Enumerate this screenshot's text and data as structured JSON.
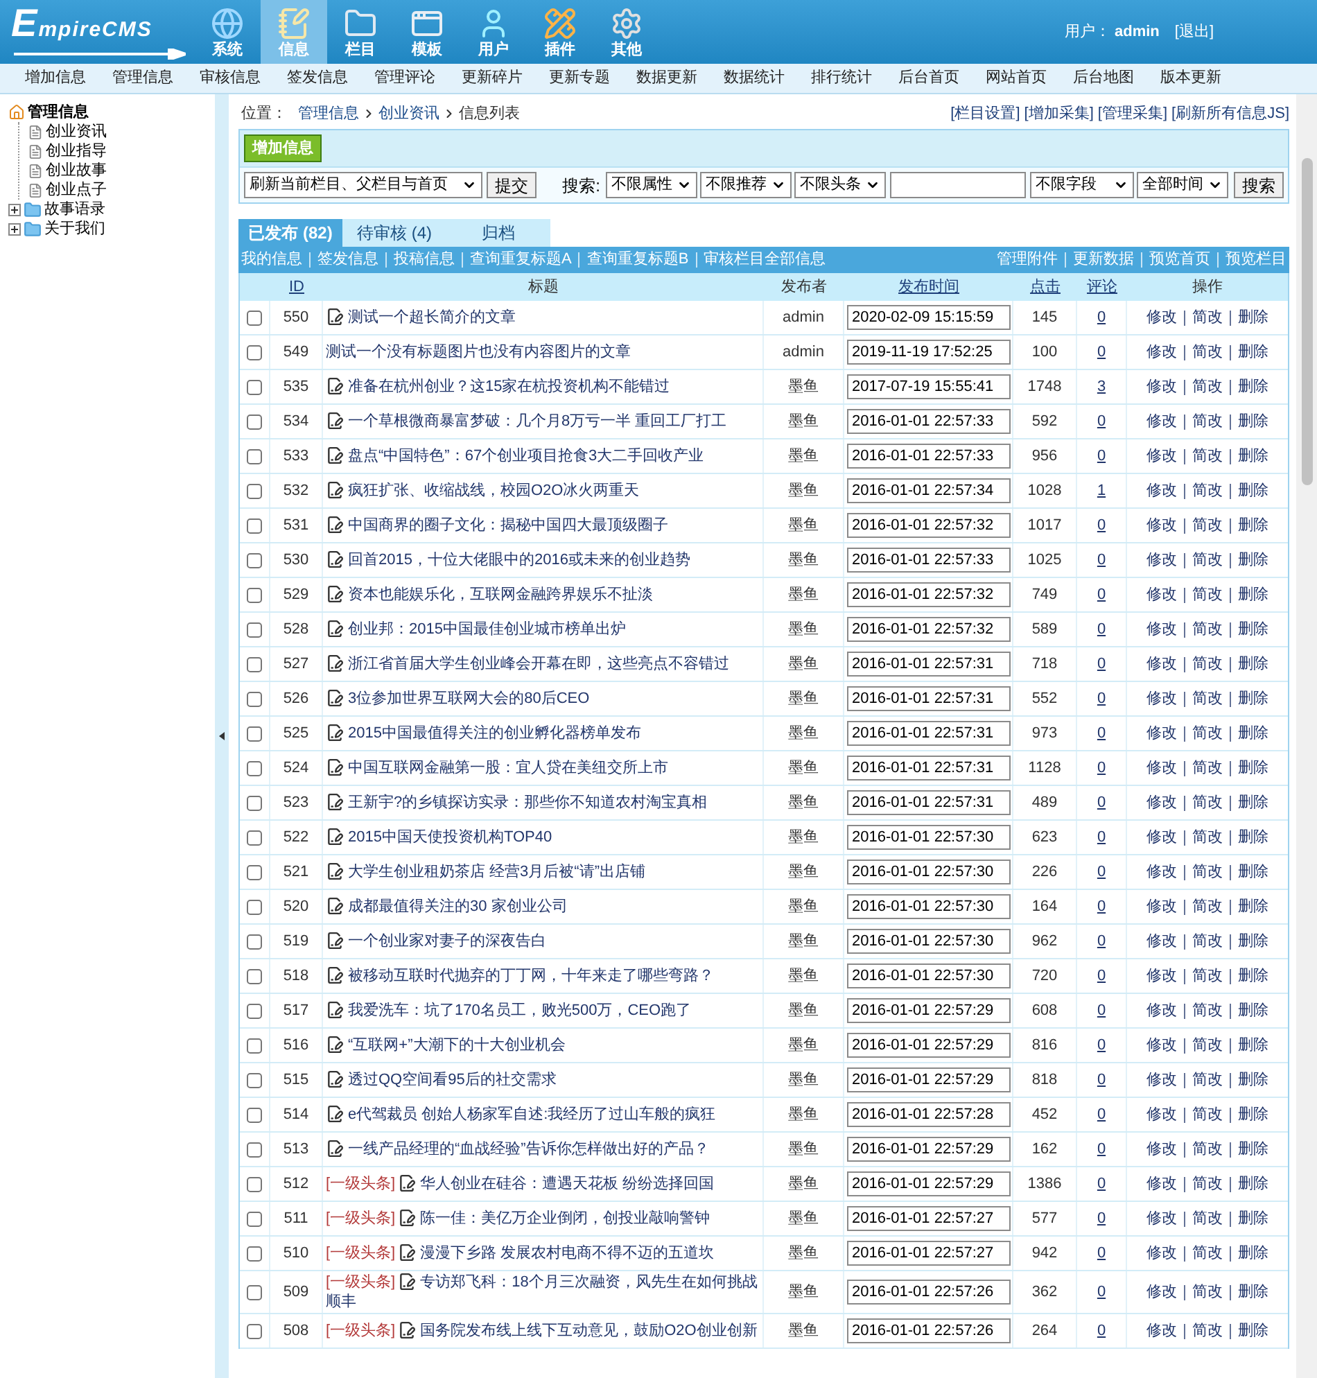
{
  "header": {
    "logo": "EmpireCMS",
    "nav": [
      {
        "label": "系统",
        "kind": "globe",
        "selected": false
      },
      {
        "label": "信息",
        "kind": "notepad",
        "selected": true
      },
      {
        "label": "栏目",
        "kind": "folder",
        "selected": false
      },
      {
        "label": "模板",
        "kind": "window",
        "selected": false
      },
      {
        "label": "用户",
        "kind": "user",
        "selected": false
      },
      {
        "label": "插件",
        "kind": "tools",
        "selected": false
      },
      {
        "label": "其他",
        "kind": "gear",
        "selected": false
      }
    ],
    "user_label": "用户：",
    "user": "admin",
    "logout": "[退出]"
  },
  "menu": [
    "增加信息",
    "管理信息",
    "审核信息",
    "签发信息",
    "管理评论",
    "更新碎片",
    "更新专题",
    "数据更新",
    "数据统计",
    "排行统计",
    "后台首页",
    "网站首页",
    "后台地图",
    "版本更新"
  ],
  "sidebar": {
    "tree": [
      {
        "label": "管理信息",
        "kind": "root",
        "expanded": true,
        "children": [
          {
            "label": "创业资讯",
            "kind": "page"
          },
          {
            "label": "创业指导",
            "kind": "page"
          },
          {
            "label": "创业故事",
            "kind": "page"
          },
          {
            "label": "创业点子",
            "kind": "page"
          }
        ]
      },
      {
        "label": "故事语录",
        "kind": "folder",
        "expanded": false
      },
      {
        "label": "关于我们",
        "kind": "folder",
        "expanded": false
      }
    ]
  },
  "breadcrumb": {
    "label": "位置：",
    "items": [
      "管理信息",
      "创业资讯",
      "信息列表"
    ]
  },
  "top_links": [
    "[栏目设置]",
    "[增加采集]",
    "[管理采集]",
    "[刷新所有信息JS]"
  ],
  "toolbar": {
    "add_button": "增加信息",
    "refresh_select": "刷新当前栏目、父栏目与首页",
    "submit_button": "提交",
    "search_label": "搜索:",
    "filters": [
      "不限属性",
      "不限推荐",
      "不限头条"
    ],
    "field_select": "不限字段",
    "time_select": "全部时间",
    "search_button": "搜索"
  },
  "tabs": [
    {
      "label": "已发布 (82)",
      "selected": true
    },
    {
      "label": "待审核 (4)",
      "selected": false
    },
    {
      "label": "归档",
      "selected": false
    }
  ],
  "sub_links_left": [
    "我的信息",
    "签发信息",
    "投稿信息",
    "查询重复标题A",
    "查询重复标题B",
    "审核栏目全部信息"
  ],
  "sub_links_right": [
    "管理附件",
    "更新数据",
    "预览首页",
    "预览栏目"
  ],
  "table": {
    "columns": [
      {
        "label": "ID",
        "sortable": true
      },
      {
        "label": "标题",
        "sortable": false
      },
      {
        "label": "发布者",
        "sortable": false
      },
      {
        "label": "发布时间",
        "sortable": true
      },
      {
        "label": "点击",
        "sortable": true
      },
      {
        "label": "评论",
        "sortable": true
      },
      {
        "label": "操作",
        "sortable": false
      }
    ],
    "rows": [
      {
        "checked": false,
        "id": "550",
        "has_icon": true,
        "title": "测试一个超长简介的文章",
        "author": "admin",
        "time": "2020-02-09 15:15:59",
        "clicks": "145",
        "comments": "0",
        "actions": [
          "修改",
          "简改",
          "删除"
        ]
      },
      {
        "checked": false,
        "id": "549",
        "has_icon": false,
        "title": "测试一个没有标题图片也没有内容图片的文章",
        "author": "admin",
        "time": "2019-11-19 17:52:25",
        "clicks": "100",
        "comments": "0",
        "actions": [
          "修改",
          "简改",
          "删除"
        ]
      },
      {
        "checked": false,
        "id": "535",
        "has_icon": true,
        "title": "准备在杭州创业？这15家在杭投资机构不能错过",
        "author": "墨鱼",
        "time": "2017-07-19 15:55:41",
        "clicks": "1748",
        "comments": "3",
        "actions": [
          "修改",
          "简改",
          "删除"
        ]
      },
      {
        "checked": false,
        "id": "534",
        "has_icon": true,
        "title": "一个草根微商暴富梦破：几个月8万亏一半 重回工厂打工",
        "author": "墨鱼",
        "time": "2016-01-01 22:57:33",
        "clicks": "592",
        "comments": "0",
        "actions": [
          "修改",
          "简改",
          "删除"
        ]
      },
      {
        "checked": false,
        "id": "533",
        "has_icon": true,
        "title": "盘点“中国特色”：67个创业项目抢食3大二手回收产业",
        "author": "墨鱼",
        "time": "2016-01-01 22:57:33",
        "clicks": "956",
        "comments": "0",
        "actions": [
          "修改",
          "简改",
          "删除"
        ]
      },
      {
        "checked": false,
        "id": "532",
        "has_icon": true,
        "title": "疯狂扩张、收缩战线，校园O2O冰火两重天",
        "author": "墨鱼",
        "time": "2016-01-01 22:57:34",
        "clicks": "1028",
        "comments": "1",
        "actions": [
          "修改",
          "简改",
          "删除"
        ]
      },
      {
        "checked": false,
        "id": "531",
        "has_icon": true,
        "title": "中国商界的圈子文化：揭秘中国四大最顶级圈子",
        "author": "墨鱼",
        "time": "2016-01-01 22:57:32",
        "clicks": "1017",
        "comments": "0",
        "actions": [
          "修改",
          "简改",
          "删除"
        ]
      },
      {
        "checked": false,
        "id": "530",
        "has_icon": true,
        "title": "回首2015，十位大佬眼中的2016或未来的创业趋势",
        "author": "墨鱼",
        "time": "2016-01-01 22:57:33",
        "clicks": "1025",
        "comments": "0",
        "actions": [
          "修改",
          "简改",
          "删除"
        ]
      },
      {
        "checked": false,
        "id": "529",
        "has_icon": true,
        "title": "资本也能娱乐化，互联网金融跨界娱乐不扯淡",
        "author": "墨鱼",
        "time": "2016-01-01 22:57:32",
        "clicks": "749",
        "comments": "0",
        "actions": [
          "修改",
          "简改",
          "删除"
        ]
      },
      {
        "checked": false,
        "id": "528",
        "has_icon": true,
        "title": "创业邦：2015中国最佳创业城市榜单出炉",
        "author": "墨鱼",
        "time": "2016-01-01 22:57:32",
        "clicks": "589",
        "comments": "0",
        "actions": [
          "修改",
          "简改",
          "删除"
        ]
      },
      {
        "checked": false,
        "id": "527",
        "has_icon": true,
        "title": "浙江省首届大学生创业峰会开幕在即，这些亮点不容错过",
        "author": "墨鱼",
        "time": "2016-01-01 22:57:31",
        "clicks": "718",
        "comments": "0",
        "actions": [
          "修改",
          "简改",
          "删除"
        ]
      },
      {
        "checked": false,
        "id": "526",
        "has_icon": true,
        "title": "3位参加世界互联网大会的80后CEO",
        "author": "墨鱼",
        "time": "2016-01-01 22:57:31",
        "clicks": "552",
        "comments": "0",
        "actions": [
          "修改",
          "简改",
          "删除"
        ]
      },
      {
        "checked": false,
        "id": "525",
        "has_icon": true,
        "title": "2015中国最值得关注的创业孵化器榜单发布",
        "author": "墨鱼",
        "time": "2016-01-01 22:57:31",
        "clicks": "973",
        "comments": "0",
        "actions": [
          "修改",
          "简改",
          "删除"
        ]
      },
      {
        "checked": false,
        "id": "524",
        "has_icon": true,
        "title": "中国互联网金融第一股：宜人贷在美纽交所上市",
        "author": "墨鱼",
        "time": "2016-01-01 22:57:31",
        "clicks": "1128",
        "comments": "0",
        "actions": [
          "修改",
          "简改",
          "删除"
        ]
      },
      {
        "checked": false,
        "id": "523",
        "has_icon": true,
        "title": "王新宇?的乡镇探访实录：那些你不知道农村淘宝真相",
        "author": "墨鱼",
        "time": "2016-01-01 22:57:31",
        "clicks": "489",
        "comments": "0",
        "actions": [
          "修改",
          "简改",
          "删除"
        ]
      },
      {
        "checked": false,
        "id": "522",
        "has_icon": true,
        "title": "2015中国天使投资机构TOP40",
        "author": "墨鱼",
        "time": "2016-01-01 22:57:30",
        "clicks": "623",
        "comments": "0",
        "actions": [
          "修改",
          "简改",
          "删除"
        ]
      },
      {
        "checked": false,
        "id": "521",
        "has_icon": true,
        "title": "大学生创业租奶茶店 经营3月后被“请”出店铺",
        "author": "墨鱼",
        "time": "2016-01-01 22:57:30",
        "clicks": "226",
        "comments": "0",
        "actions": [
          "修改",
          "简改",
          "删除"
        ]
      },
      {
        "checked": false,
        "id": "520",
        "has_icon": true,
        "title": "成都最值得关注的30 家创业公司",
        "author": "墨鱼",
        "time": "2016-01-01 22:57:30",
        "clicks": "164",
        "comments": "0",
        "actions": [
          "修改",
          "简改",
          "删除"
        ]
      },
      {
        "checked": false,
        "id": "519",
        "has_icon": true,
        "title": "一个创业家对妻子的深夜告白",
        "author": "墨鱼",
        "time": "2016-01-01 22:57:30",
        "clicks": "962",
        "comments": "0",
        "actions": [
          "修改",
          "简改",
          "删除"
        ]
      },
      {
        "checked": false,
        "id": "518",
        "has_icon": true,
        "title": "被移动互联时代抛弃的丁丁网，十年来走了哪些弯路？",
        "author": "墨鱼",
        "time": "2016-01-01 22:57:30",
        "clicks": "720",
        "comments": "0",
        "actions": [
          "修改",
          "简改",
          "删除"
        ]
      },
      {
        "checked": false,
        "id": "517",
        "has_icon": true,
        "title": "我爱洗车：坑了170名员工，败光500万，CEO跑了",
        "author": "墨鱼",
        "time": "2016-01-01 22:57:29",
        "clicks": "608",
        "comments": "0",
        "actions": [
          "修改",
          "简改",
          "删除"
        ]
      },
      {
        "checked": false,
        "id": "516",
        "has_icon": true,
        "title": "“互联网+”大潮下的十大创业机会",
        "author": "墨鱼",
        "time": "2016-01-01 22:57:29",
        "clicks": "816",
        "comments": "0",
        "actions": [
          "修改",
          "简改",
          "删除"
        ]
      },
      {
        "checked": false,
        "id": "515",
        "has_icon": true,
        "title": "透过QQ空间看95后的社交需求",
        "author": "墨鱼",
        "time": "2016-01-01 22:57:29",
        "clicks": "818",
        "comments": "0",
        "actions": [
          "修改",
          "简改",
          "删除"
        ]
      },
      {
        "checked": false,
        "id": "514",
        "has_icon": true,
        "title": "e代驾裁员 创始人杨家军自述:我经历了过山车般的疯狂",
        "author": "墨鱼",
        "time": "2016-01-01 22:57:28",
        "clicks": "452",
        "comments": "0",
        "actions": [
          "修改",
          "简改",
          "删除"
        ]
      },
      {
        "checked": false,
        "id": "513",
        "has_icon": true,
        "title": "一线产品经理的“血战经验”告诉你怎样做出好的产品？",
        "author": "墨鱼",
        "time": "2016-01-01 22:57:29",
        "clicks": "162",
        "comments": "0",
        "actions": [
          "修改",
          "简改",
          "删除"
        ]
      },
      {
        "checked": false,
        "id": "512",
        "tag": "[一级头条]",
        "has_icon": true,
        "title": "华人创业在硅谷：遭遇天花板 纷纷选择回国",
        "author": "墨鱼",
        "time": "2016-01-01 22:57:29",
        "clicks": "1386",
        "comments": "0",
        "actions": [
          "修改",
          "简改",
          "删除"
        ]
      },
      {
        "checked": false,
        "id": "511",
        "tag": "[一级头条]",
        "has_icon": true,
        "title": "陈一佳：美亿万企业倒闭，创投业敲响警钟",
        "author": "墨鱼",
        "time": "2016-01-01 22:57:27",
        "clicks": "577",
        "comments": "0",
        "actions": [
          "修改",
          "简改",
          "删除"
        ]
      },
      {
        "checked": false,
        "id": "510",
        "tag": "[一级头条]",
        "has_icon": true,
        "title": "漫漫下乡路 发展农村电商不得不迈的五道坎",
        "author": "墨鱼",
        "time": "2016-01-01 22:57:27",
        "clicks": "942",
        "comments": "0",
        "actions": [
          "修改",
          "简改",
          "删除"
        ]
      },
      {
        "checked": false,
        "id": "509",
        "tag": "[一级头条]",
        "has_icon": true,
        "title": "专访郑飞科：18个月三次融资，风先生在如何挑战顺丰",
        "author": "墨鱼",
        "time": "2016-01-01 22:57:26",
        "clicks": "362",
        "comments": "0",
        "actions": [
          "修改",
          "简改",
          "删除"
        ]
      },
      {
        "checked": false,
        "id": "508",
        "tag": "[一级头条]",
        "has_icon": true,
        "title": "国务院发布线上线下互动意见，鼓励O2O创业创新",
        "author": "墨鱼",
        "time": "2016-01-01 22:57:26",
        "clicks": "264",
        "comments": "0",
        "actions": [
          "修改",
          "简改",
          "删除"
        ]
      }
    ]
  }
}
